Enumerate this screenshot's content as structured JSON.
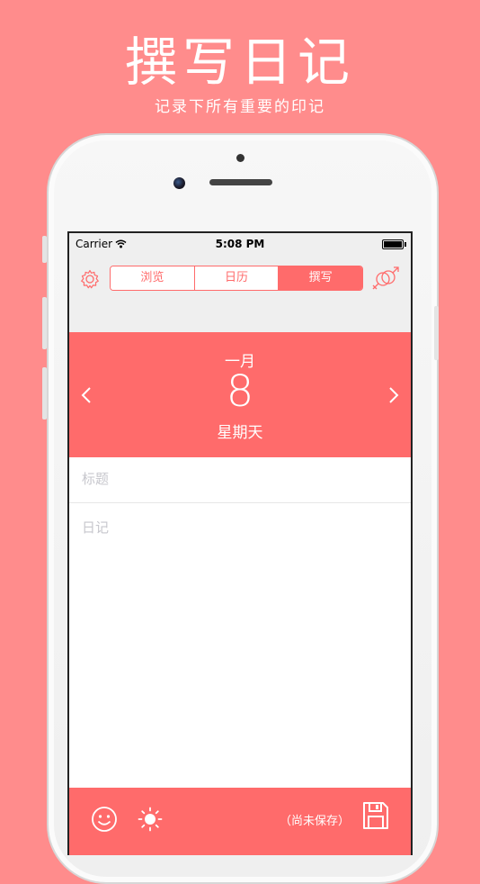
{
  "hero": {
    "title": "撰写日记",
    "subtitle": "记录下所有重要的印记"
  },
  "status_bar": {
    "carrier": "Carrier",
    "time": "5:08 PM"
  },
  "nav": {
    "tabs": [
      {
        "label": "浏览",
        "active": false
      },
      {
        "label": "日历",
        "active": false
      },
      {
        "label": "撰写",
        "active": true
      }
    ],
    "left_icon": "gear-icon",
    "right_icon": "gender-icon"
  },
  "date": {
    "month": "一月",
    "day": "8",
    "weekday": "星期天"
  },
  "editor": {
    "title_placeholder": "标题",
    "body_placeholder": "日记"
  },
  "toolbar": {
    "save_status": "（尚未保存）",
    "icons": [
      "smiley-icon",
      "sun-icon",
      "save-icon"
    ]
  },
  "colors": {
    "background": "#ff8c8c",
    "accent": "#ff6b6b",
    "white": "#ffffff"
  }
}
